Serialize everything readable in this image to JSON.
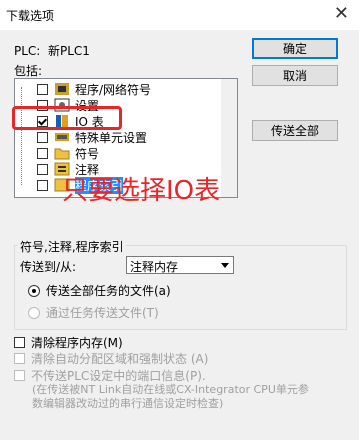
{
  "window": {
    "title": "下载选项"
  },
  "plc": {
    "label": "PLC:",
    "name": "新PLC1"
  },
  "include": {
    "label": "包括:"
  },
  "tree": {
    "items": [
      {
        "label": "程序/网络符号",
        "checked": false,
        "icon": "program-icon"
      },
      {
        "label": "设置",
        "checked": false,
        "icon": "settings-icon"
      },
      {
        "label": "IO 表",
        "checked": true,
        "icon": "io-table-icon"
      },
      {
        "label": "特殊单元设置",
        "checked": false,
        "icon": "special-unit-icon"
      },
      {
        "label": "符号",
        "checked": false,
        "icon": "symbol-icon"
      },
      {
        "label": "注释",
        "checked": false,
        "icon": "comment-icon"
      },
      {
        "label": "程序索引",
        "checked": false,
        "icon": "index-icon"
      }
    ]
  },
  "buttons": {
    "ok": "确定",
    "cancel": "取消",
    "transfer_all": "传送全部"
  },
  "annotation": {
    "text": "只要选择IO表",
    "color": "#e8262a"
  },
  "group": {
    "title": "符号,注释,程序索引",
    "transfer_label": "传送到/从:",
    "transfer_value": "注释内存",
    "radio_all": "传送全部任务的文件(a)",
    "radio_task": "通过任务传送文件(T)"
  },
  "options": {
    "clear_program": "清除程序内存(M)",
    "clear_auto": "清除自动分配区域和强制状态 (A)",
    "no_transfer": "不传送PLC设定中的端口信息(P).",
    "note_line1": "(在传送被NT Link自动在线或CX-Integrator CPU单元参",
    "note_line2": "数编辑器改动过的串行通信设定时检查)"
  }
}
